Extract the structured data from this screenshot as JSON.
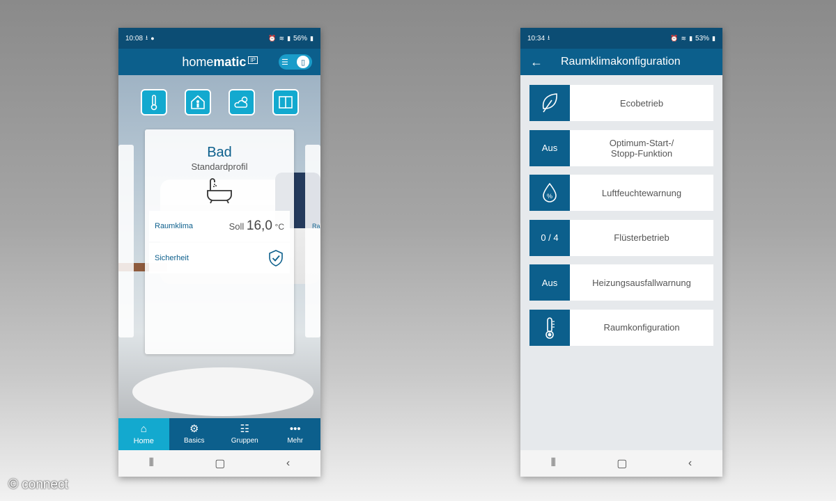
{
  "left_phone": {
    "status": {
      "time": "10:08",
      "battery": "56%"
    },
    "header": {
      "logo_regular": "home",
      "logo_bold": "matic",
      "logo_badge": "IP"
    },
    "categories": [
      {
        "icon": "thermometer-icon"
      },
      {
        "icon": "house-person-icon"
      },
      {
        "icon": "weather-icon"
      },
      {
        "icon": "window-icon"
      }
    ],
    "room": {
      "name": "Bad",
      "profile": "Standardprofil",
      "icon": "bathtub-icon",
      "raumklima_label": "Raumklima",
      "soll_label": "Soll",
      "soll_value": "16,0",
      "soll_unit": "°C",
      "sicherheit_label": "Sicherheit"
    },
    "side_peek": {
      "right_label": "Ra"
    },
    "nav": [
      {
        "label": "Home",
        "icon": "home-icon"
      },
      {
        "label": "Basics",
        "icon": "gear-icon"
      },
      {
        "label": "Gruppen",
        "icon": "groups-icon"
      },
      {
        "label": "Mehr",
        "icon": "more-icon"
      }
    ]
  },
  "right_phone": {
    "status": {
      "time": "10:34",
      "battery": "53%"
    },
    "title": "Raumklimakonfiguration",
    "items": [
      {
        "badge": "",
        "icon": "leaf-icon",
        "label": "Ecobetrieb"
      },
      {
        "badge": "Aus",
        "label": "Optimum-Start-/\nStopp-Funktion"
      },
      {
        "badge": "",
        "icon": "humidity-icon",
        "label": "Luftfeuchtewarnung"
      },
      {
        "badge": "0 / 4",
        "label": "Flüsterbetrieb"
      },
      {
        "badge": "Aus",
        "label": "Heizungsausfallwarnung"
      },
      {
        "badge": "",
        "icon": "thermometer-icon",
        "label": "Raumkonfiguration"
      }
    ]
  },
  "watermark": "© connect",
  "colors": {
    "primary": "#0c5f8c",
    "accent": "#13a9cf",
    "status_bar": "#0c4d74"
  }
}
